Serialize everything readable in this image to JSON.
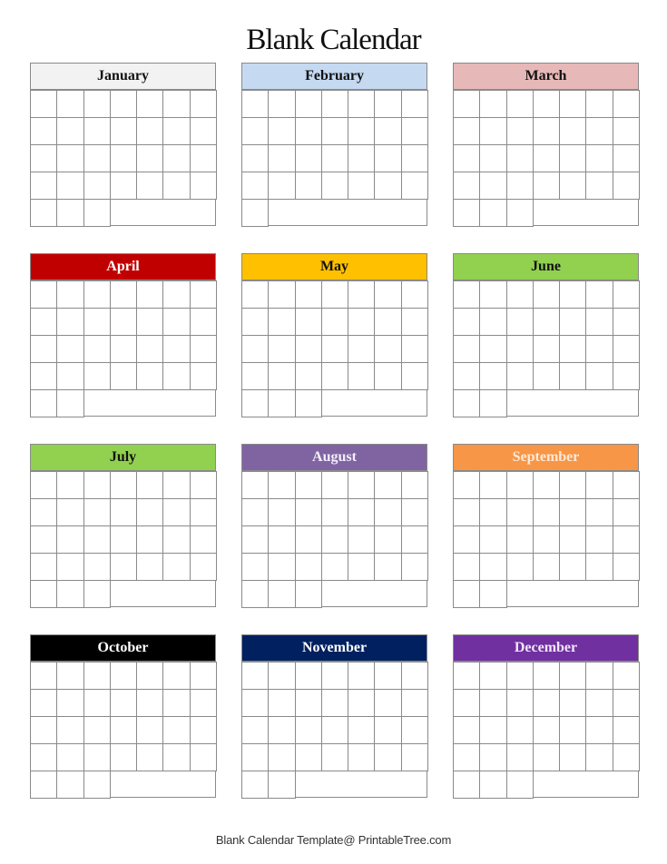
{
  "document": {
    "title": "Blank Calendar",
    "footer": "Blank Calendar Template@ PrintableTree.com"
  },
  "grid_spec": {
    "columns": 7,
    "rows": 5
  },
  "months": [
    {
      "name": "January",
      "header_bg": "#f2f2f2",
      "header_text": "#111111",
      "last_row_cells": 3
    },
    {
      "name": "February",
      "header_bg": "#c5d9f1",
      "header_text": "#111111",
      "last_row_cells": 1
    },
    {
      "name": "March",
      "header_bg": "#e6b8b7",
      "header_text": "#111111",
      "last_row_cells": 3
    },
    {
      "name": "April",
      "header_bg": "#c00000",
      "header_text": "#ffffff",
      "last_row_cells": 2
    },
    {
      "name": "May",
      "header_bg": "#ffc000",
      "header_text": "#111111",
      "last_row_cells": 3
    },
    {
      "name": "June",
      "header_bg": "#92d050",
      "header_text": "#111111",
      "last_row_cells": 2
    },
    {
      "name": "July",
      "header_bg": "#92d050",
      "header_text": "#111111",
      "last_row_cells": 3
    },
    {
      "name": "August",
      "header_bg": "#8064a2",
      "header_text": "#f3eefa",
      "last_row_cells": 3
    },
    {
      "name": "September",
      "header_bg": "#f79646",
      "header_text": "#fde9d9",
      "last_row_cells": 2
    },
    {
      "name": "October",
      "header_bg": "#000000",
      "header_text": "#ffffff",
      "last_row_cells": 3
    },
    {
      "name": "November",
      "header_bg": "#002060",
      "header_text": "#ffffff",
      "last_row_cells": 2
    },
    {
      "name": "December",
      "header_bg": "#7030a0",
      "header_text": "#f1e6fa",
      "last_row_cells": 3
    }
  ]
}
